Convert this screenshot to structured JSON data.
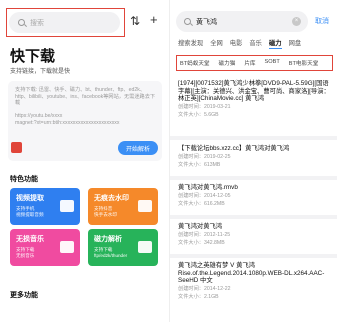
{
  "left": {
    "search_placeholder": "搜索",
    "sort_icon": "sort-icon",
    "add_icon": "plus-icon",
    "title": "快下载",
    "subtitle": "支持链接，下载就是快",
    "paste_hint": "支持下载: 迅雷、快手、磁力、bt、thunder、ftp、ed2k、http、bilibili、youtube、ins、facebook等网站，无需迷路去下载\n\nhttps://youtu.be/xxxx\nmagnet:?xt=urn:btih:xxxxxxxxxxxxxxxxxxxxxx",
    "parse_button": "开始解析",
    "features_heading": "特色功能",
    "features": [
      {
        "name": "视频提取",
        "desc": "支持手机\n视频提取音频",
        "color": "#2f7ff0"
      },
      {
        "name": "无痕去水印",
        "desc": "支持抖音\n快手去水印",
        "color": "#f5892a"
      },
      {
        "name": "无损音乐",
        "desc": "支持下载\n无损音乐",
        "color": "#f04ba0"
      },
      {
        "name": "磁力解析",
        "desc": "支持下载\nftp/ed2k/thunder",
        "color": "#27b35a"
      }
    ],
    "more_heading": "更多功能"
  },
  "right": {
    "search_value": "黄飞鸿",
    "cancel": "取消",
    "engine_tabs": [
      "搜索发现",
      "全网",
      "电影",
      "音乐",
      "磁力",
      "网盘"
    ],
    "engine_active": 4,
    "source_tabs": [
      "BT蚂蚁天堂",
      "磁力猫",
      "片库",
      "SOBT",
      "BT电影天堂"
    ],
    "results": [
      {
        "title": "[1974][0071532]黄飞鸿少林拳[DVD9-PAL-5.59G][国语字幕][主演：关德兴、洪金宝、曹可尚、商家洛][导演：林正英][ChinaMovie.cc] 黄飞鸿",
        "created": "创建时间：2019-03-21",
        "size": "文件大小：5.6GB"
      },
      {
        "title": "【下载论坛bbs.xzz.cc】黄飞鸿对黄飞鸿",
        "created": "创建时间：2019-02-25",
        "size": "文件大小：613MB"
      },
      {
        "title": "黄飞鸿对黄飞鸿.rmvb",
        "created": "创建时间：2014-12-05",
        "size": "文件大小：616.2MB"
      },
      {
        "title": "黄飞鸿对黄飞鸿",
        "created": "创建时间：2012-11-25",
        "size": "文件大小：342.8MB"
      },
      {
        "title": "黄飞鸿之英雄有梦 V 黄飞鸿 Rise.of.the.Legend.2014.1080p.WEB-DL.x264.AAC-SeeHD 中文",
        "created": "创建时间：2014-12-22",
        "size": "文件大小：2.1GB"
      }
    ]
  }
}
